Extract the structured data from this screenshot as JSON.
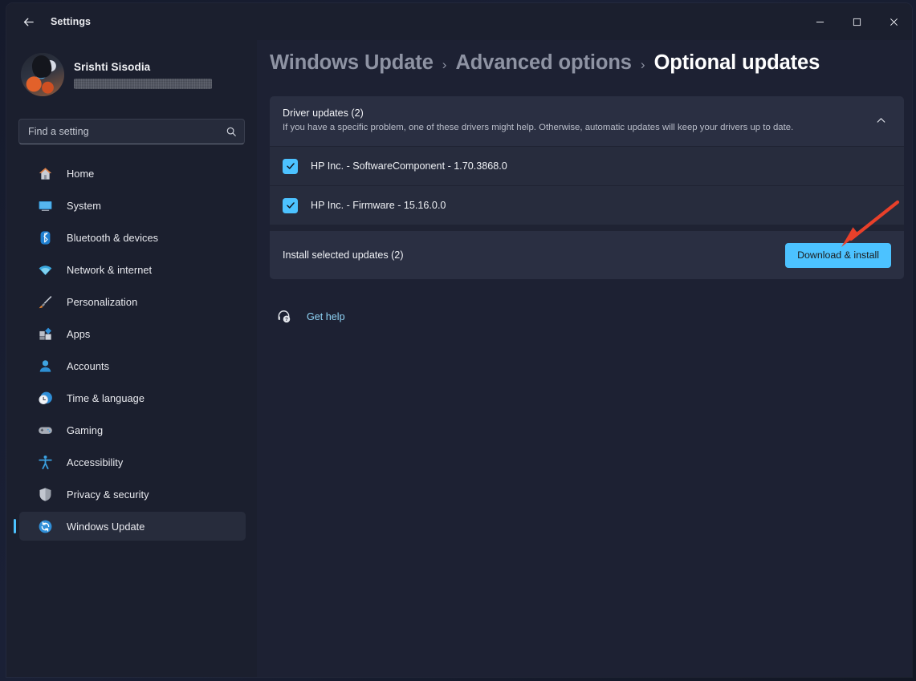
{
  "window": {
    "app_title": "Settings",
    "back_icon": "back-arrow-icon",
    "minimize_label": "Minimize",
    "maximize_label": "Maximize",
    "close_label": "Close"
  },
  "account": {
    "name": "Srishti Sisodia",
    "email_redacted": true,
    "avatar_icon": "user-avatar"
  },
  "search": {
    "placeholder": "Find a setting",
    "value": "",
    "icon": "search-icon"
  },
  "sidebar": {
    "items": [
      {
        "label": "Home",
        "icon": "home-icon",
        "selected": false
      },
      {
        "label": "System",
        "icon": "system-icon",
        "selected": false
      },
      {
        "label": "Bluetooth & devices",
        "icon": "bluetooth-icon",
        "selected": false
      },
      {
        "label": "Network & internet",
        "icon": "network-icon",
        "selected": false
      },
      {
        "label": "Personalization",
        "icon": "paintbrush-icon",
        "selected": false
      },
      {
        "label": "Apps",
        "icon": "apps-icon",
        "selected": false
      },
      {
        "label": "Accounts",
        "icon": "accounts-icon",
        "selected": false
      },
      {
        "label": "Time & language",
        "icon": "clock-icon",
        "selected": false
      },
      {
        "label": "Gaming",
        "icon": "gamepad-icon",
        "selected": false
      },
      {
        "label": "Accessibility",
        "icon": "accessibility-icon",
        "selected": false
      },
      {
        "label": "Privacy & security",
        "icon": "shield-icon",
        "selected": false
      },
      {
        "label": "Windows Update",
        "icon": "update-refresh-icon",
        "selected": true
      }
    ]
  },
  "breadcrumb": {
    "items": [
      {
        "label": "Windows Update",
        "current": false
      },
      {
        "label": "Advanced options",
        "current": false
      },
      {
        "label": "Optional updates",
        "current": true
      }
    ],
    "separator": "›"
  },
  "driver_card": {
    "title": "Driver updates (2)",
    "description": "If you have a specific problem, one of these drivers might help. Otherwise, automatic updates will keep your drivers up to date.",
    "expanded": true,
    "chevron_icon": "chevron-up-icon",
    "updates": [
      {
        "label": "HP Inc. - SoftwareComponent - 1.70.3868.0",
        "checked": true
      },
      {
        "label": "HP Inc. - Firmware - 15.16.0.0",
        "checked": true
      }
    ]
  },
  "install_row": {
    "label": "Install selected updates (2)",
    "button_label": "Download & install"
  },
  "get_help": {
    "label": "Get help",
    "icon": "help-headset-icon"
  },
  "annotation": {
    "type": "arrow",
    "color": "#e8402a",
    "points_to": "Download & install"
  },
  "colors": {
    "accent": "#4cc2ff",
    "window_bg": "#1d2133",
    "sidebar_bg": "#1b1f2e",
    "card_bg": "#2a2f42",
    "row_bg": "#272c3d",
    "annotation_red": "#e8402a"
  }
}
